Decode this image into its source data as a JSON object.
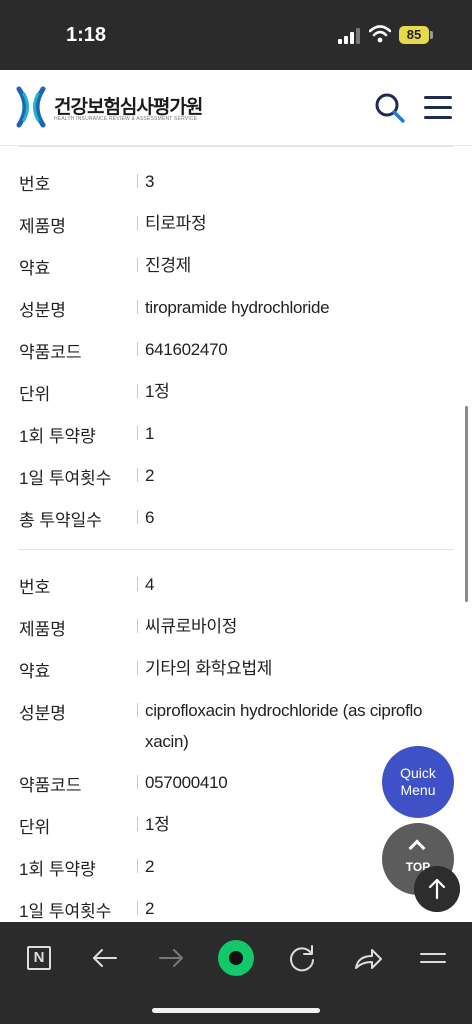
{
  "status_bar": {
    "time": "1:18",
    "battery": "85"
  },
  "header": {
    "title": "건강보험심사평가원",
    "subtitle": "HEALTH INSURANCE REVIEW & ASSESSMENT SERVICE"
  },
  "records": [
    {
      "rows": [
        {
          "label": "번호",
          "value": "3"
        },
        {
          "label": "제품명",
          "value": "티로파정"
        },
        {
          "label": "약효",
          "value": "진경제"
        },
        {
          "label": "성분명",
          "value": "tiropramide hydrochloride"
        },
        {
          "label": "약품코드",
          "value": "641602470"
        },
        {
          "label": "단위",
          "value": "1정"
        },
        {
          "label": "1회 투약량",
          "value": "1"
        },
        {
          "label": "1일 투여횟수",
          "value": "2"
        },
        {
          "label": "총 투약일수",
          "value": "6"
        }
      ]
    },
    {
      "rows": [
        {
          "label": "번호",
          "value": "4"
        },
        {
          "label": "제품명",
          "value": "씨큐로바이정"
        },
        {
          "label": "약효",
          "value": "기타의 화학요법제"
        },
        {
          "label": "성분명",
          "value": "ciprofloxacin hydrochloride (as ciproflo xacin)"
        },
        {
          "label": "약품코드",
          "value": "057000410"
        },
        {
          "label": "단위",
          "value": "1정"
        },
        {
          "label": "1회 투약량",
          "value": "2"
        },
        {
          "label": "1일 투여횟수",
          "value": "2"
        }
      ]
    }
  ],
  "floating": {
    "quick_menu_line1": "Quick",
    "quick_menu_line2": "Menu",
    "top_label": "TOP"
  },
  "colors": {
    "accent": "#3f51c7",
    "brand_navy": "#1f2b4d",
    "browser_green": "#12c86a"
  },
  "toolbar_icons": [
    "n-icon",
    "back-arrow-icon",
    "forward-arrow-icon",
    "green-dot-icon",
    "reload-icon",
    "share-icon",
    "menu-icon"
  ]
}
